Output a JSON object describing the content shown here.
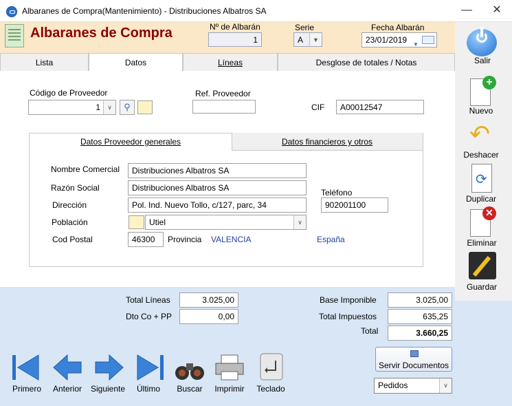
{
  "window": {
    "title": "Albaranes de Compra(Mantenimiento) - Distribuciones Albatros SA",
    "minimize": "—",
    "close": "✕"
  },
  "header": {
    "heading": "Albaranes de Compra",
    "num_label": "Nº de Albarán",
    "num_value": "1",
    "serie_label": "Serie",
    "serie_value": "A",
    "fecha_label": "Fecha Albarán",
    "fecha_value": "23/01/2019"
  },
  "tabs": [
    {
      "label": "Lista"
    },
    {
      "label": "Datos"
    },
    {
      "label": "Líneas"
    },
    {
      "label": "Desglose de totales / Notas"
    }
  ],
  "proveedor": {
    "codigo_label": "Código de Proveedor",
    "codigo_value": "1",
    "ref_label": "Ref. Proveedor",
    "ref_value": "",
    "cif_label": "CIF",
    "cif_value": "A00012547"
  },
  "inner_tabs": [
    {
      "label": "Datos Proveedor generales"
    },
    {
      "label": "Datos financieros y otros"
    }
  ],
  "datos": {
    "nombre_label": "Nombre Comercial",
    "nombre_value": "Distribuciones Albatros SA",
    "razon_label": "Razón Social",
    "razon_value": "Distribuciones Albatros SA",
    "direccion_label": "Dirección",
    "direccion_value": "Pol. Ind. Nuevo Tollo, c/127, parc, 34",
    "poblacion_label": "Población",
    "poblacion_value": "Utiel",
    "cp_label": "Cod Postal",
    "cp_value": "46300",
    "provincia_label": "Provincia",
    "provincia_value": "VALENCIA",
    "pais_value": "España",
    "telefono_label": "Teléfono",
    "telefono_value": "902001100"
  },
  "totals": {
    "total_lineas_label": "Total Líneas",
    "total_lineas_value": "3.025,00",
    "dto_label": "Dto Co + PP",
    "dto_value": "0,00",
    "base_label": "Base Imponible",
    "base_value": "3.025,00",
    "impuestos_label": "Total Impuestos",
    "impuestos_value": "635,25",
    "total_label": "Total",
    "total_value": "3.660,25"
  },
  "right_toolbar": [
    {
      "label": "Salir"
    },
    {
      "label": "Nuevo"
    },
    {
      "label": "Deshacer"
    },
    {
      "label": "Duplicar"
    },
    {
      "label": "Eliminar"
    },
    {
      "label": "Guardar"
    }
  ],
  "nav": [
    {
      "label": "Primero"
    },
    {
      "label": "Anterior"
    },
    {
      "label": "Siguiente"
    },
    {
      "label": "Último"
    },
    {
      "label": "Buscar"
    },
    {
      "label": "Imprimir"
    },
    {
      "label": "Teclado"
    }
  ],
  "servir": {
    "button_label": "Servir Documentos",
    "select_value": "Pedidos"
  },
  "colors": {
    "header_bg": "#fbe8c8",
    "heading": "#8b0000",
    "bottom_bg": "#d9e6f5",
    "blue_text": "#1f3fa0"
  }
}
